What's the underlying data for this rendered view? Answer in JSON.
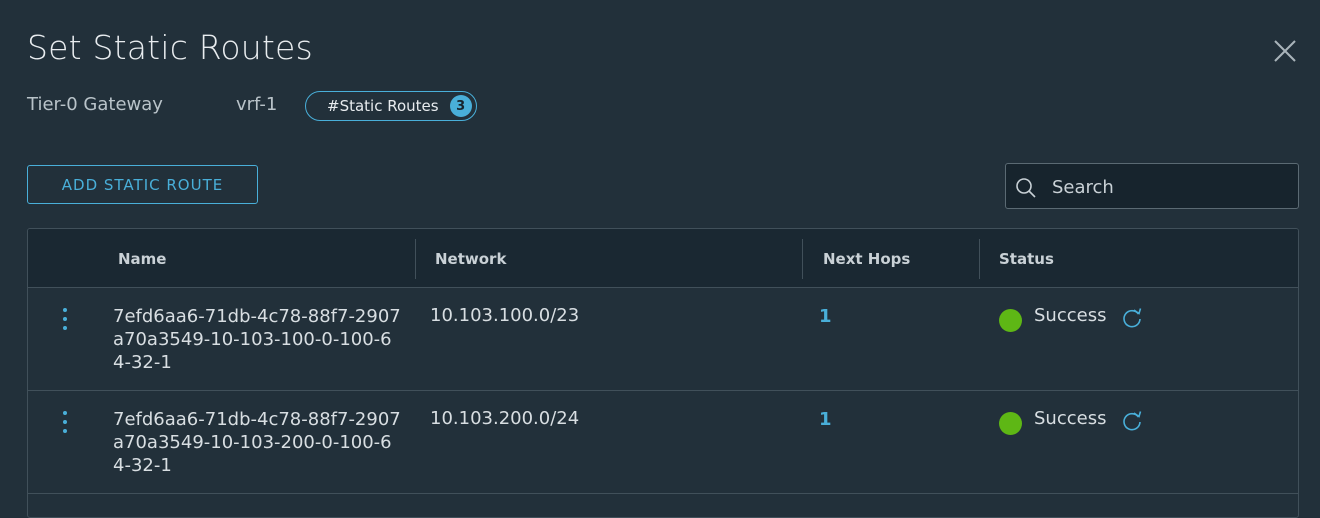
{
  "dialog": {
    "title": "Set Static Routes",
    "gateway_label": "Tier-0 Gateway",
    "vrf_name": "vrf-1",
    "pill_label": "#Static Routes",
    "pill_count": "3"
  },
  "toolbar": {
    "add_label": "ADD STATIC ROUTE",
    "search_placeholder": "Search"
  },
  "table": {
    "columns": [
      "Name",
      "Network",
      "Next Hops",
      "Status"
    ],
    "rows": [
      {
        "name": "7efd6aa6-71db-4c78-88f7-2907a70a3549-10-103-100-0-100-64-32-1",
        "network": "10.103.100.0/23",
        "next_hops": "1",
        "status": "Success"
      },
      {
        "name": "7efd6aa6-71db-4c78-88f7-2907a70a3549-10-103-200-0-100-64-32-1",
        "network": "10.103.200.0/24",
        "next_hops": "1",
        "status": "Success"
      }
    ]
  },
  "icons": {
    "close": "close-icon",
    "search": "search-icon",
    "row_menu": "vertical-ellipsis-icon",
    "status_dot": "status-dot-icon",
    "refresh": "refresh-icon"
  },
  "colors": {
    "background": "#22303a",
    "accent": "#49afd9",
    "success": "#5eb715",
    "header_bg": "#1a2832"
  }
}
